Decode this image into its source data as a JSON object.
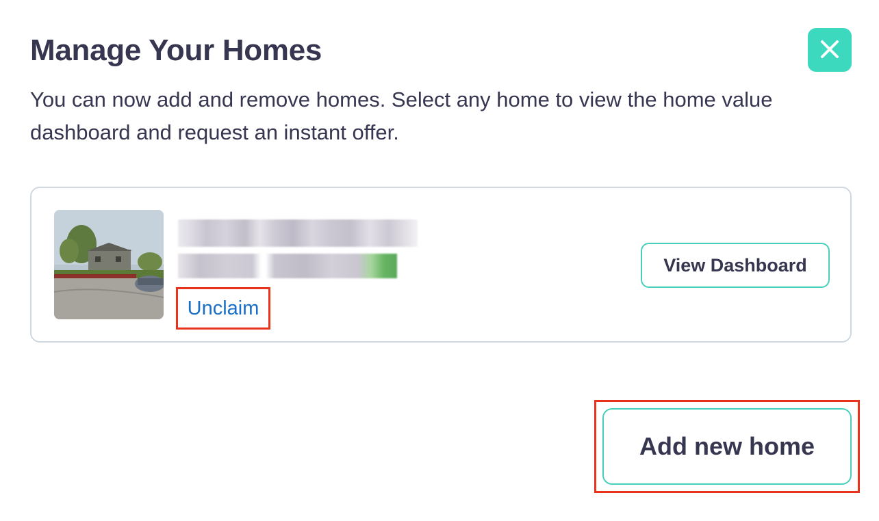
{
  "header": {
    "title": "Manage Your Homes",
    "close_icon": "close-icon",
    "description": "You can now add and remove homes. Select any home to view the home value dashboard and request an instant offer."
  },
  "homes": [
    {
      "photo_icon": "home-street-photo",
      "unclaim_label": "Unclaim",
      "view_dashboard_label": "View Dashboard"
    }
  ],
  "footer": {
    "add_home_label": "Add new home"
  },
  "colors": {
    "accent": "#3dd9bf",
    "button_border": "#47cfbc",
    "text": "#363650",
    "link": "#1a6fc4",
    "highlight": "#e8341c"
  }
}
